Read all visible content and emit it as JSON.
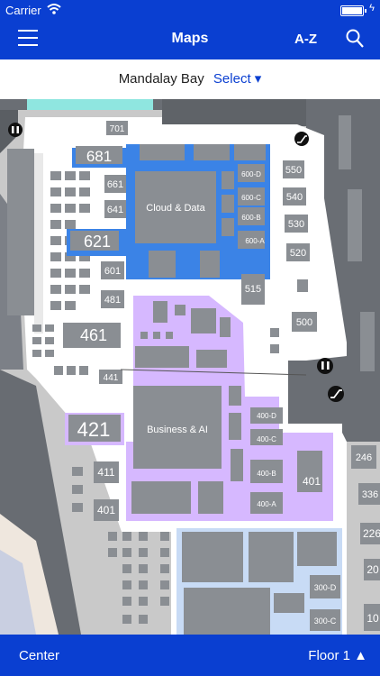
{
  "status_bar": {
    "carrier": "Carrier"
  },
  "nav": {
    "title": "Maps",
    "az_label": "A-Z"
  },
  "venue": {
    "name": "Mandalay Bay",
    "select_label": "Select ▾"
  },
  "map": {
    "zones": {
      "cloud": "Cloud & Data",
      "business": "Business & AI"
    },
    "rooms": {
      "r701": "701",
      "r681": "681",
      "r661": "661",
      "r641": "641",
      "r621": "621",
      "r601": "601",
      "r481": "481",
      "r461": "461",
      "r441": "441",
      "r421": "421",
      "r411": "411",
      "r401a": "401",
      "r401b": "401",
      "r600d": "600-D",
      "r600c": "600-C",
      "r600b": "600-B",
      "r600a": "600-A",
      "r550": "550",
      "r540": "540",
      "r530": "530",
      "r520": "520",
      "r515": "515",
      "r500": "500",
      "r400d": "400-D",
      "r400c": "400-C",
      "r400b": "400-B",
      "r400a": "400-A",
      "r300d": "300-D",
      "r300c": "300-C",
      "r246": "246",
      "r336": "336",
      "r226": "226",
      "r20": "20",
      "r10": "10"
    }
  },
  "bottom_bar": {
    "center_label": "Center",
    "floor_label": "Floor 1 ▲"
  },
  "colors": {
    "brand": "#0a3fd1",
    "cloud_zone": "#3b83e6",
    "business_zone": "#d6b8ff",
    "lower_zone": "#c8dbf5"
  }
}
